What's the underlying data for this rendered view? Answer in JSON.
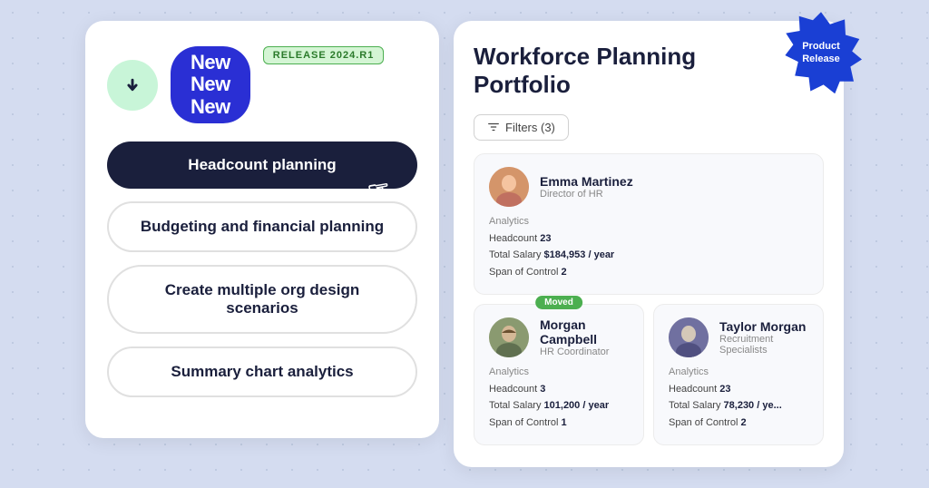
{
  "left_card": {
    "logo_icon": "↓",
    "new_text": "New\nNew\nNew",
    "release_badge": "RELEASE 2024.R1",
    "nav_items": [
      {
        "id": "headcount",
        "label": "Headcount planning",
        "active": true
      },
      {
        "id": "budgeting",
        "label": "Budgeting and financial planning",
        "active": false
      },
      {
        "id": "org-design",
        "label": "Create multiple org design scenarios",
        "active": false
      },
      {
        "id": "summary",
        "label": "Summary chart analytics",
        "active": false
      }
    ]
  },
  "right_card": {
    "title": "Workforce Planning\nPortfolio",
    "filter_label": "Filters (3)",
    "product_release_line1": "Product",
    "product_release_line2": "Release",
    "people": [
      {
        "id": "emma",
        "name": "Emma Martinez",
        "title": "Director of HR",
        "analytics_label": "Analytics",
        "headcount": "23",
        "total_salary": "$184,953 / year",
        "span_of_control": "2",
        "moved": false,
        "size": "full"
      },
      {
        "id": "morgan",
        "name": "Morgan Campbell",
        "title": "HR Coordinator",
        "analytics_label": "Analytics",
        "headcount": "3",
        "total_salary": "101,200 / year",
        "span_of_control": "1",
        "moved": true,
        "size": "half"
      },
      {
        "id": "taylor",
        "name": "Taylor Morgan",
        "title": "Recruitment Specialists",
        "analytics_label": "Analytics",
        "headcount": "23",
        "total_salary": "78,230 / ye...",
        "span_of_control": "2",
        "moved": false,
        "size": "half"
      }
    ]
  }
}
